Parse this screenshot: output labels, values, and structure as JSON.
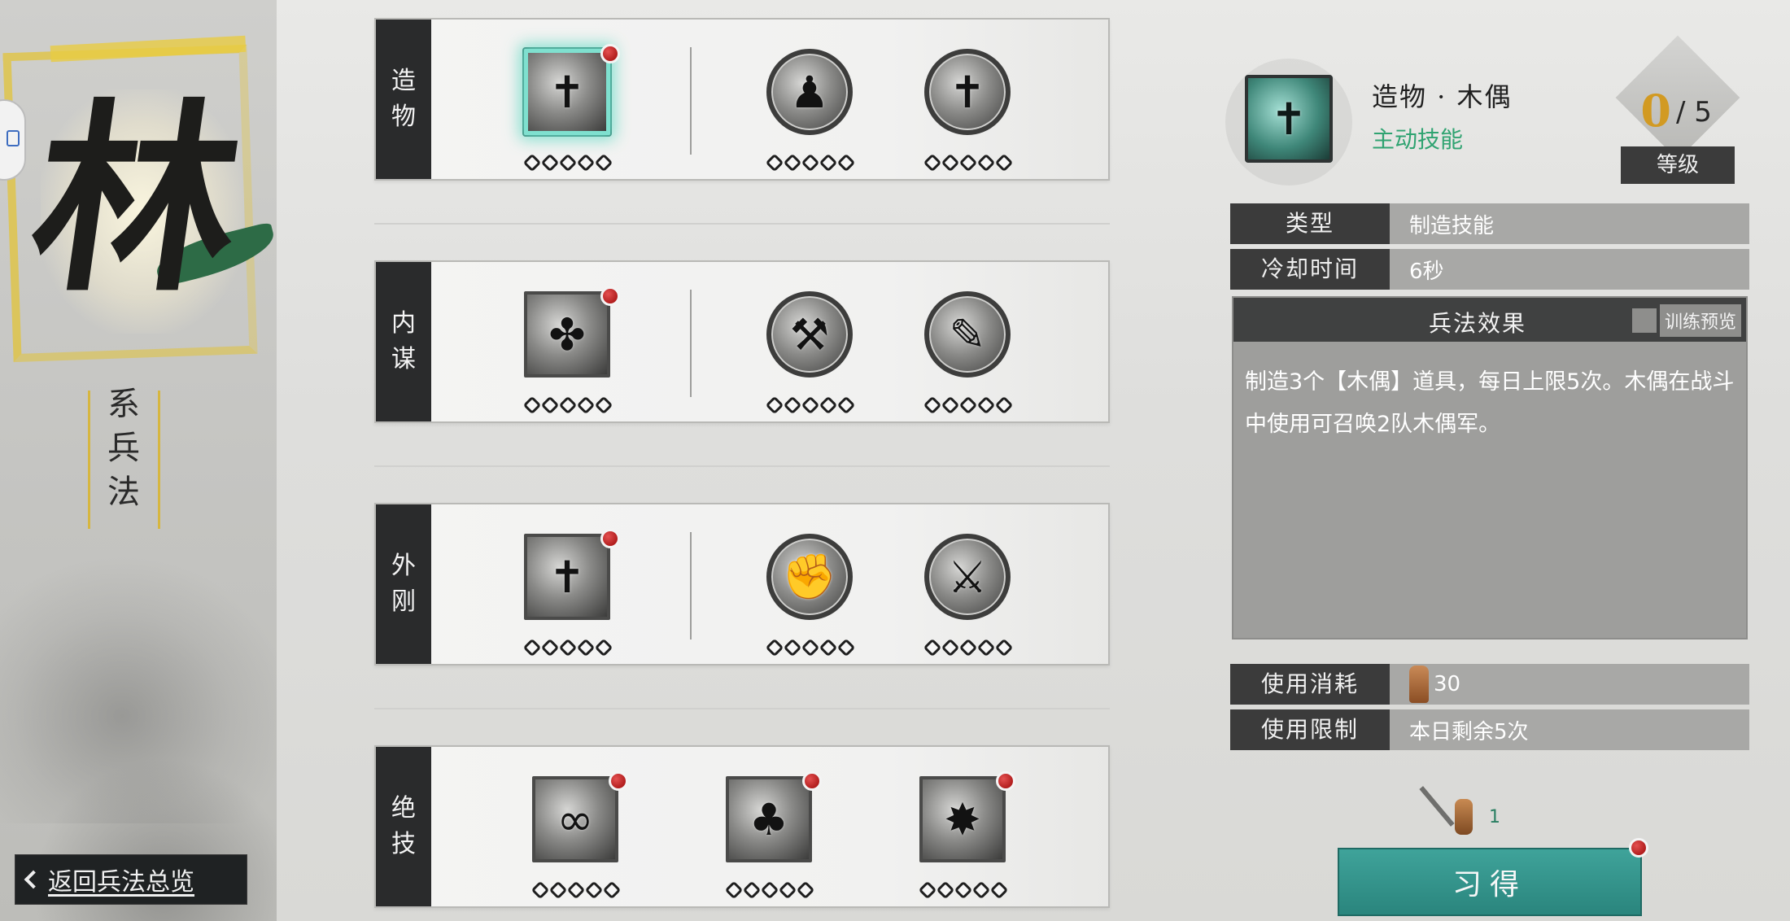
{
  "school": {
    "emblem_char": "林",
    "subtitle": "系兵法",
    "back_label": "返回兵法总览"
  },
  "tiers": [
    {
      "label": "造物",
      "skills": [
        {
          "icon": "puppet-icon",
          "glyph": "✝",
          "level": 0,
          "max": 5,
          "selected": true,
          "new": true
        },
        {
          "icon": "summon-figure-icon",
          "glyph": "♟",
          "level": 0,
          "max": 5
        },
        {
          "icon": "tomb-icon",
          "glyph": "✝",
          "level": 0,
          "max": 5
        }
      ]
    },
    {
      "label": "内谋",
      "skills": [
        {
          "icon": "leaf-bird-icon",
          "glyph": "✤",
          "level": 0,
          "max": 5,
          "new": true
        },
        {
          "icon": "hammer-icon",
          "glyph": "⚒",
          "level": 0,
          "max": 5
        },
        {
          "icon": "scroll-icon",
          "glyph": "✎",
          "level": 0,
          "max": 5
        }
      ]
    },
    {
      "label": "外刚",
      "skills": [
        {
          "icon": "stone-icon",
          "glyph": "✝",
          "level": 0,
          "max": 5,
          "new": true
        },
        {
          "icon": "gauntlet-icon",
          "glyph": "✊",
          "level": 0,
          "max": 5
        },
        {
          "icon": "warriors-icon",
          "glyph": "⚔",
          "level": 0,
          "max": 5
        }
      ]
    },
    {
      "label": "绝技",
      "skills": [
        {
          "icon": "serpent-icon",
          "glyph": "∞",
          "level": 0,
          "max": 5,
          "new": true
        },
        {
          "icon": "tree-icon",
          "glyph": "♣",
          "level": 0,
          "max": 5,
          "new": true
        },
        {
          "icon": "sun-icon",
          "glyph": "✸",
          "level": 0,
          "max": 5,
          "new": true
        }
      ]
    }
  ],
  "detail": {
    "name": "造物 · 木偶",
    "kind": "主动技能",
    "level_current": "0",
    "level_separator": "/ 5",
    "level_label": "等级",
    "type_key": "类型",
    "type_value": "制造技能",
    "cooldown_key": "冷却时间",
    "cooldown_value": "6秒",
    "effect_title": "兵法效果",
    "effect_toggle": "训练预览",
    "effect_text": "制造3个【木偶】道具，每日上限5次。木偶在战斗中使用可召唤2队木偶军。",
    "cost_key": "使用消耗",
    "cost_value": "30",
    "limit_key": "使用限制",
    "limit_value": "本日剩余5次"
  },
  "learn": {
    "owned_count": "1",
    "button_label": "习得"
  },
  "colors": {
    "accent_teal": "#2a857d",
    "skill_type_green": "#2fa371",
    "level_gold": "#d29a22",
    "notice_red": "#b21e1e"
  }
}
